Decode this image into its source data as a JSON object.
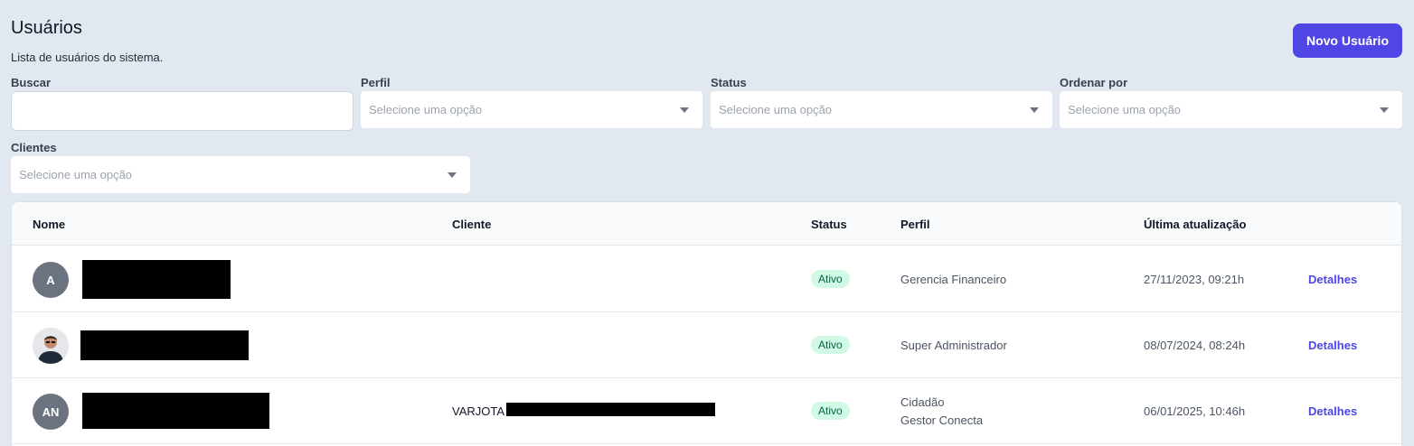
{
  "header": {
    "title": "Usuários",
    "subtitle": "Lista de usuários do sistema.",
    "new_user_label": "Novo Usuário"
  },
  "filters": {
    "search": {
      "label": "Buscar",
      "value": ""
    },
    "profile": {
      "label": "Perfil",
      "placeholder": "Selecione uma opção"
    },
    "status": {
      "label": "Status",
      "placeholder": "Selecione uma opção"
    },
    "order": {
      "label": "Ordenar por",
      "placeholder": "Selecione uma opção"
    },
    "clients": {
      "label": "Clientes",
      "placeholder": "Selecione uma opção"
    }
  },
  "table": {
    "columns": {
      "name": "Nome",
      "client": "Cliente",
      "status": "Status",
      "profile": "Perfil",
      "updated": "Última atualização"
    },
    "rows": [
      {
        "avatar": "A",
        "client": "",
        "status": "Ativo",
        "profile_1": "Gerencia Financeiro",
        "profile_2": "",
        "updated": "27/11/2023, 09:21h",
        "action": "Detalhes"
      },
      {
        "avatar": "",
        "client": "",
        "status": "Ativo",
        "profile_1": "Super Administrador",
        "profile_2": "",
        "updated": "08/07/2024, 08:24h",
        "action": "Detalhes"
      },
      {
        "avatar": "AN",
        "client": "VARJOTA",
        "status": "Ativo",
        "profile_1": "Cidadão",
        "profile_2": "Gestor Conecta",
        "updated": "06/01/2025, 10:46h",
        "action": "Detalhes"
      }
    ]
  },
  "colors": {
    "accent": "#4f46e5",
    "background": "#e2e8f0",
    "badge_bg": "#d1fae5",
    "badge_text": "#065f46"
  }
}
